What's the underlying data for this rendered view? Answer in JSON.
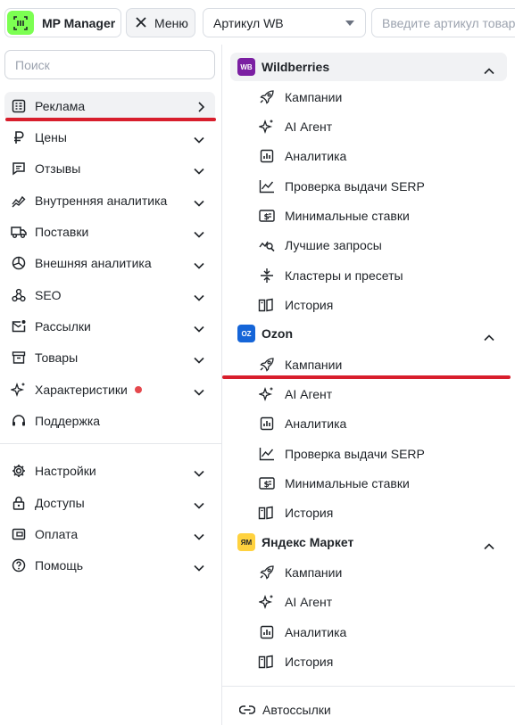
{
  "topbar": {
    "brand": "MP Manager",
    "menu_label": "Меню",
    "marketplace_select": "Артикул WB",
    "article_placeholder": "Введите артикул товара"
  },
  "sidebar": {
    "search_placeholder": "Поиск",
    "items": [
      {
        "label": "Реклама",
        "icon": "megaphone-icon",
        "active": true
      },
      {
        "label": "Цены",
        "icon": "ruble-icon"
      },
      {
        "label": "Отзывы",
        "icon": "chat-icon"
      },
      {
        "label": "Внутренняя аналитика",
        "icon": "trend-icon"
      },
      {
        "label": "Поставки",
        "icon": "truck-icon"
      },
      {
        "label": "Внешняя аналитика",
        "icon": "pie-chart-icon"
      },
      {
        "label": "SEO",
        "icon": "webhook-icon"
      },
      {
        "label": "Рассылки",
        "icon": "mail-icon"
      },
      {
        "label": "Товары",
        "icon": "archive-icon"
      },
      {
        "label": "Характеристики",
        "icon": "sparkle-icon",
        "badge": "new-dot"
      },
      {
        "label": "Поддержка",
        "icon": "headset-icon"
      }
    ],
    "bottom_items": [
      {
        "label": "Настройки",
        "icon": "gear-icon"
      },
      {
        "label": "Доступы",
        "icon": "lock-icon"
      },
      {
        "label": "Оплата",
        "icon": "wallet-icon"
      },
      {
        "label": "Помощь",
        "icon": "help-icon"
      }
    ]
  },
  "panel": {
    "groups": [
      {
        "name": "Wildberries",
        "badge": "WB",
        "badge_color": "#7b1fa2",
        "items": [
          "Кампании",
          "AI Агент",
          "Аналитика",
          "Проверка выдачи SERP",
          "Минимальные ставки",
          "Лучшие запросы",
          "Кластеры и пресеты",
          "История"
        ]
      },
      {
        "name": "Ozon",
        "badge": "OZ",
        "badge_color": "#1565d8",
        "items": [
          "Кампании",
          "AI Агент",
          "Аналитика",
          "Проверка выдачи SERP",
          "Минимальные ставки",
          "История"
        ]
      },
      {
        "name": "Яндекс Маркет",
        "badge": "ЯМ",
        "badge_color": "#ffd23f",
        "items": [
          "Кампании",
          "AI Агент",
          "Аналитика",
          "История"
        ]
      }
    ],
    "autolinks": "Автоссылки"
  },
  "colors": {
    "brand_green": "#7cff52",
    "highlight_red": "#d81e2c",
    "active_bg": "#f1f2f4"
  }
}
